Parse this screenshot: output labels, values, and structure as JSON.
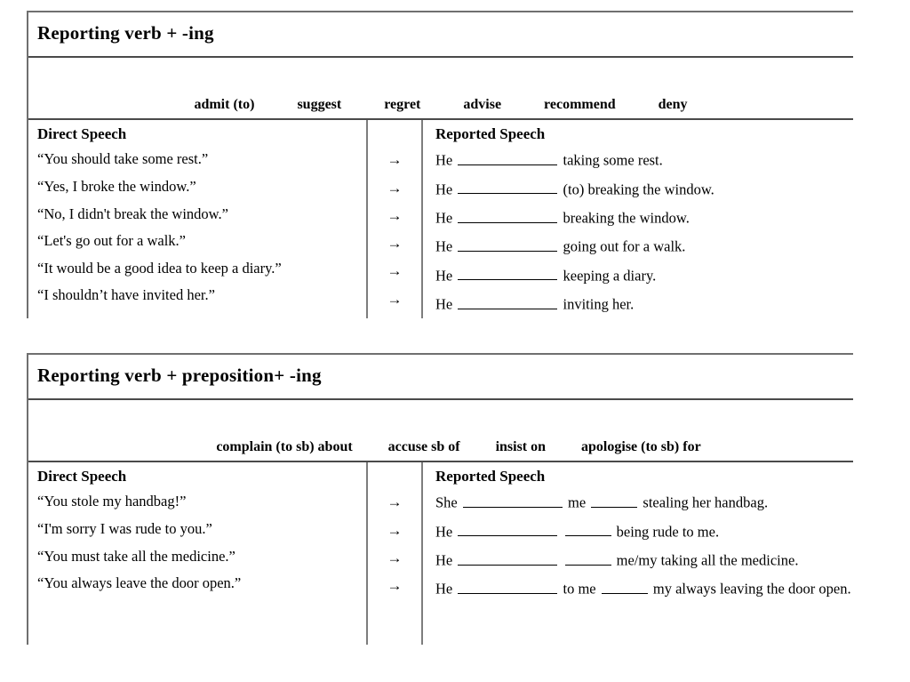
{
  "worksheet": {
    "sections": [
      {
        "title": "Reporting verb + -ing",
        "verbs": [
          "admit (to)",
          "suggest",
          "regret",
          "advise",
          "recommend",
          "deny"
        ],
        "columns": {
          "direct": "Direct Speech",
          "reported": "Reported Speech",
          "arrow": "→"
        },
        "rows": [
          {
            "direct": "“You should take some rest.”",
            "reported_pre": "He",
            "reported_mid": "",
            "reported_post": "taking some rest.",
            "blanks": 1
          },
          {
            "direct": "“Yes, I broke the window.”",
            "reported_pre": "He",
            "reported_mid": "",
            "reported_post": "(to) breaking the window.",
            "blanks": 1
          },
          {
            "direct": "“No, I didn't break the window.”",
            "reported_pre": "He",
            "reported_mid": "",
            "reported_post": "breaking the window.",
            "blanks": 1
          },
          {
            "direct": "“Let's go out for a walk.”",
            "reported_pre": "He",
            "reported_mid": "",
            "reported_post": "going out for a walk.",
            "blanks": 1
          },
          {
            "direct": "“It would be a good idea to keep a diary.”",
            "reported_pre": "He",
            "reported_mid": "",
            "reported_post": "keeping a diary.",
            "blanks": 1
          },
          {
            "direct": "“I shouldn’t have invited her.”",
            "reported_pre": "He",
            "reported_mid": "",
            "reported_post": "inviting her.",
            "blanks": 1
          }
        ]
      },
      {
        "title": "Reporting verb + preposition+ -ing",
        "verbs": [
          "complain (to sb) about",
          "accuse sb of",
          "insist on",
          "apologise (to sb) for"
        ],
        "columns": {
          "direct": "Direct Speech",
          "reported": "Reported Speech",
          "arrow": "→"
        },
        "rows": [
          {
            "direct": "“You stole my handbag!”",
            "reported_pre": "She",
            "reported_mid": "me",
            "reported_post": "stealing her handbag.",
            "blanks": 2
          },
          {
            "direct": "“I'm sorry I was rude to you.”",
            "reported_pre": "He",
            "reported_mid": "",
            "reported_post": "being rude to me.",
            "blanks": 2
          },
          {
            "direct": "“You must take all the medicine.”",
            "reported_pre": "He",
            "reported_mid": "",
            "reported_post": "me/my taking all the medicine.",
            "blanks": 2
          },
          {
            "direct": "“You always leave the door open.”",
            "reported_pre": "He",
            "reported_mid": "to me",
            "reported_post": "my always leaving the door open.",
            "blanks": 2
          }
        ]
      }
    ]
  }
}
